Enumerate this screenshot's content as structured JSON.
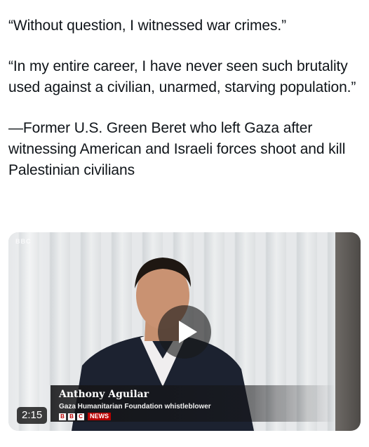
{
  "post": {
    "paragraphs": [
      "“Without question, I witnessed war crimes.”",
      "“In my entire career, I have never seen such brutality used against a civilian, unarmed, starving population.”",
      "—Former U.S. Green Beret who left Gaza after witnessing American and Israeli forces shoot and kill Palestinian civilians"
    ]
  },
  "video": {
    "duration": "2:15",
    "corner_watermark": "BBC",
    "lower_third": {
      "name": "Anthony Aguilar",
      "role": "Gaza Humanitarian Foundation whistleblower",
      "logo_letters": [
        "B",
        "B",
        "C"
      ],
      "logo_word": "NEWS"
    }
  },
  "colors": {
    "text": "#0f1419",
    "bbc_red": "#b80000"
  }
}
